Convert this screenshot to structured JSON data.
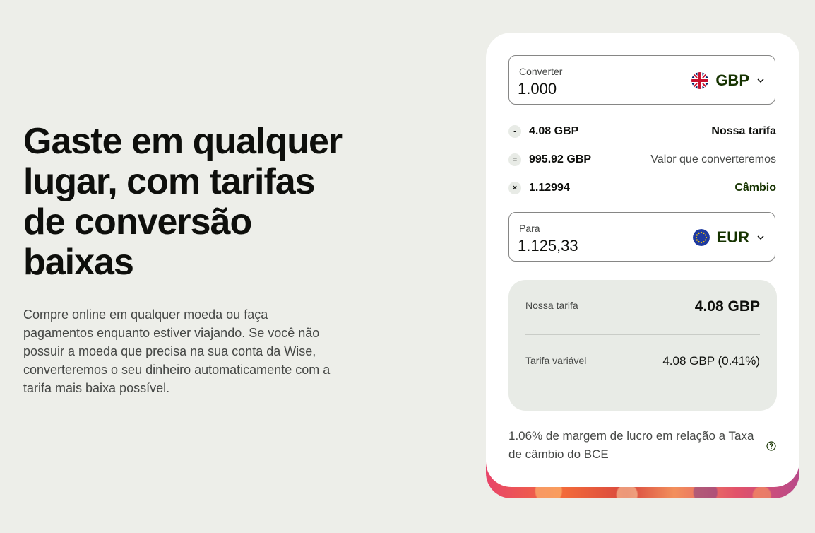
{
  "hero": {
    "title": "Gaste em qualquer lugar, com tarifas de conversão baixas",
    "description": "Compre online em qualquer moeda ou faça pagamentos enquanto estiver viajando. Se você não possuir a moeda que precisa na sua conta da Wise, converteremos o seu dinheiro automaticamente com a tarifa mais baixa possível."
  },
  "converter": {
    "from": {
      "label": "Converter",
      "amount": "1.000",
      "currency": "GBP",
      "flag_icon": "uk-flag-icon"
    },
    "fees": [
      {
        "operator": "-",
        "value": "4.08 GBP",
        "label": "Nossa tarifa"
      },
      {
        "operator": "=",
        "value": "995.92 GBP",
        "label": "Valor que converteremos"
      },
      {
        "operator": "×",
        "value": "1.12994",
        "label": "Câmbio"
      }
    ],
    "to": {
      "label": "Para",
      "amount": "1.125,33",
      "currency": "EUR",
      "flag_icon": "eu-flag-icon"
    },
    "breakdown": {
      "fee_label": "Nossa tarifa",
      "fee_value": "4.08 GBP",
      "variable_label": "Tarifa variável",
      "variable_value": "4.08 GBP (0.41%)"
    },
    "footnote": "1.06% de margem de lucro em relação a  Taxa de câmbio do BCE"
  },
  "colors": {
    "background": "#edeee9",
    "card": "#ffffff",
    "panel": "#e8ebe6",
    "forest_green": "#163300"
  }
}
